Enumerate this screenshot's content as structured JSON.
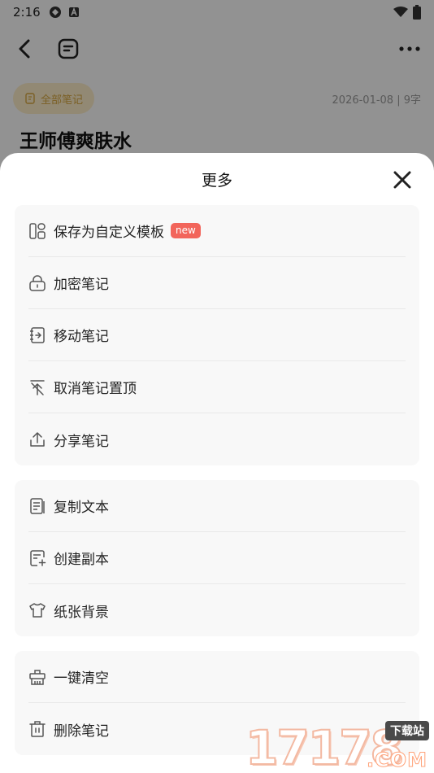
{
  "status_bar": {
    "time": "2:16",
    "left_icons": [
      "app-icon-1",
      "app-icon-a"
    ],
    "right_icons": [
      "wifi-icon",
      "battery-icon"
    ]
  },
  "background_page": {
    "folder_chip": "全部笔记",
    "meta": "2026-01-08 | 9字",
    "title": "王师傅爽肤水"
  },
  "sheet": {
    "title": "更多",
    "groups": [
      {
        "items": [
          {
            "label": "保存为自定义模板",
            "icon": "template-icon",
            "badge": "new"
          },
          {
            "label": "加密笔记",
            "icon": "lock-icon"
          },
          {
            "label": "移动笔记",
            "icon": "move-icon"
          },
          {
            "label": "取消笔记置顶",
            "icon": "unpin-icon"
          },
          {
            "label": "分享笔记",
            "icon": "share-icon"
          }
        ]
      },
      {
        "items": [
          {
            "label": "复制文本",
            "icon": "copy-text-icon"
          },
          {
            "label": "创建副本",
            "icon": "duplicate-icon"
          },
          {
            "label": "纸张背景",
            "icon": "paper-background-icon"
          }
        ]
      },
      {
        "items": [
          {
            "label": "一键清空",
            "icon": "clear-icon"
          },
          {
            "label": "删除笔记",
            "icon": "trash-icon"
          }
        ]
      }
    ]
  },
  "watermark": {
    "digits": "17178",
    "tag": "下载站",
    "suffix": ".COM"
  },
  "colors": {
    "badge": "#f2655b",
    "chip_bg": "#fbecc9",
    "chip_text": "#d5a640",
    "icon": "#555555"
  }
}
